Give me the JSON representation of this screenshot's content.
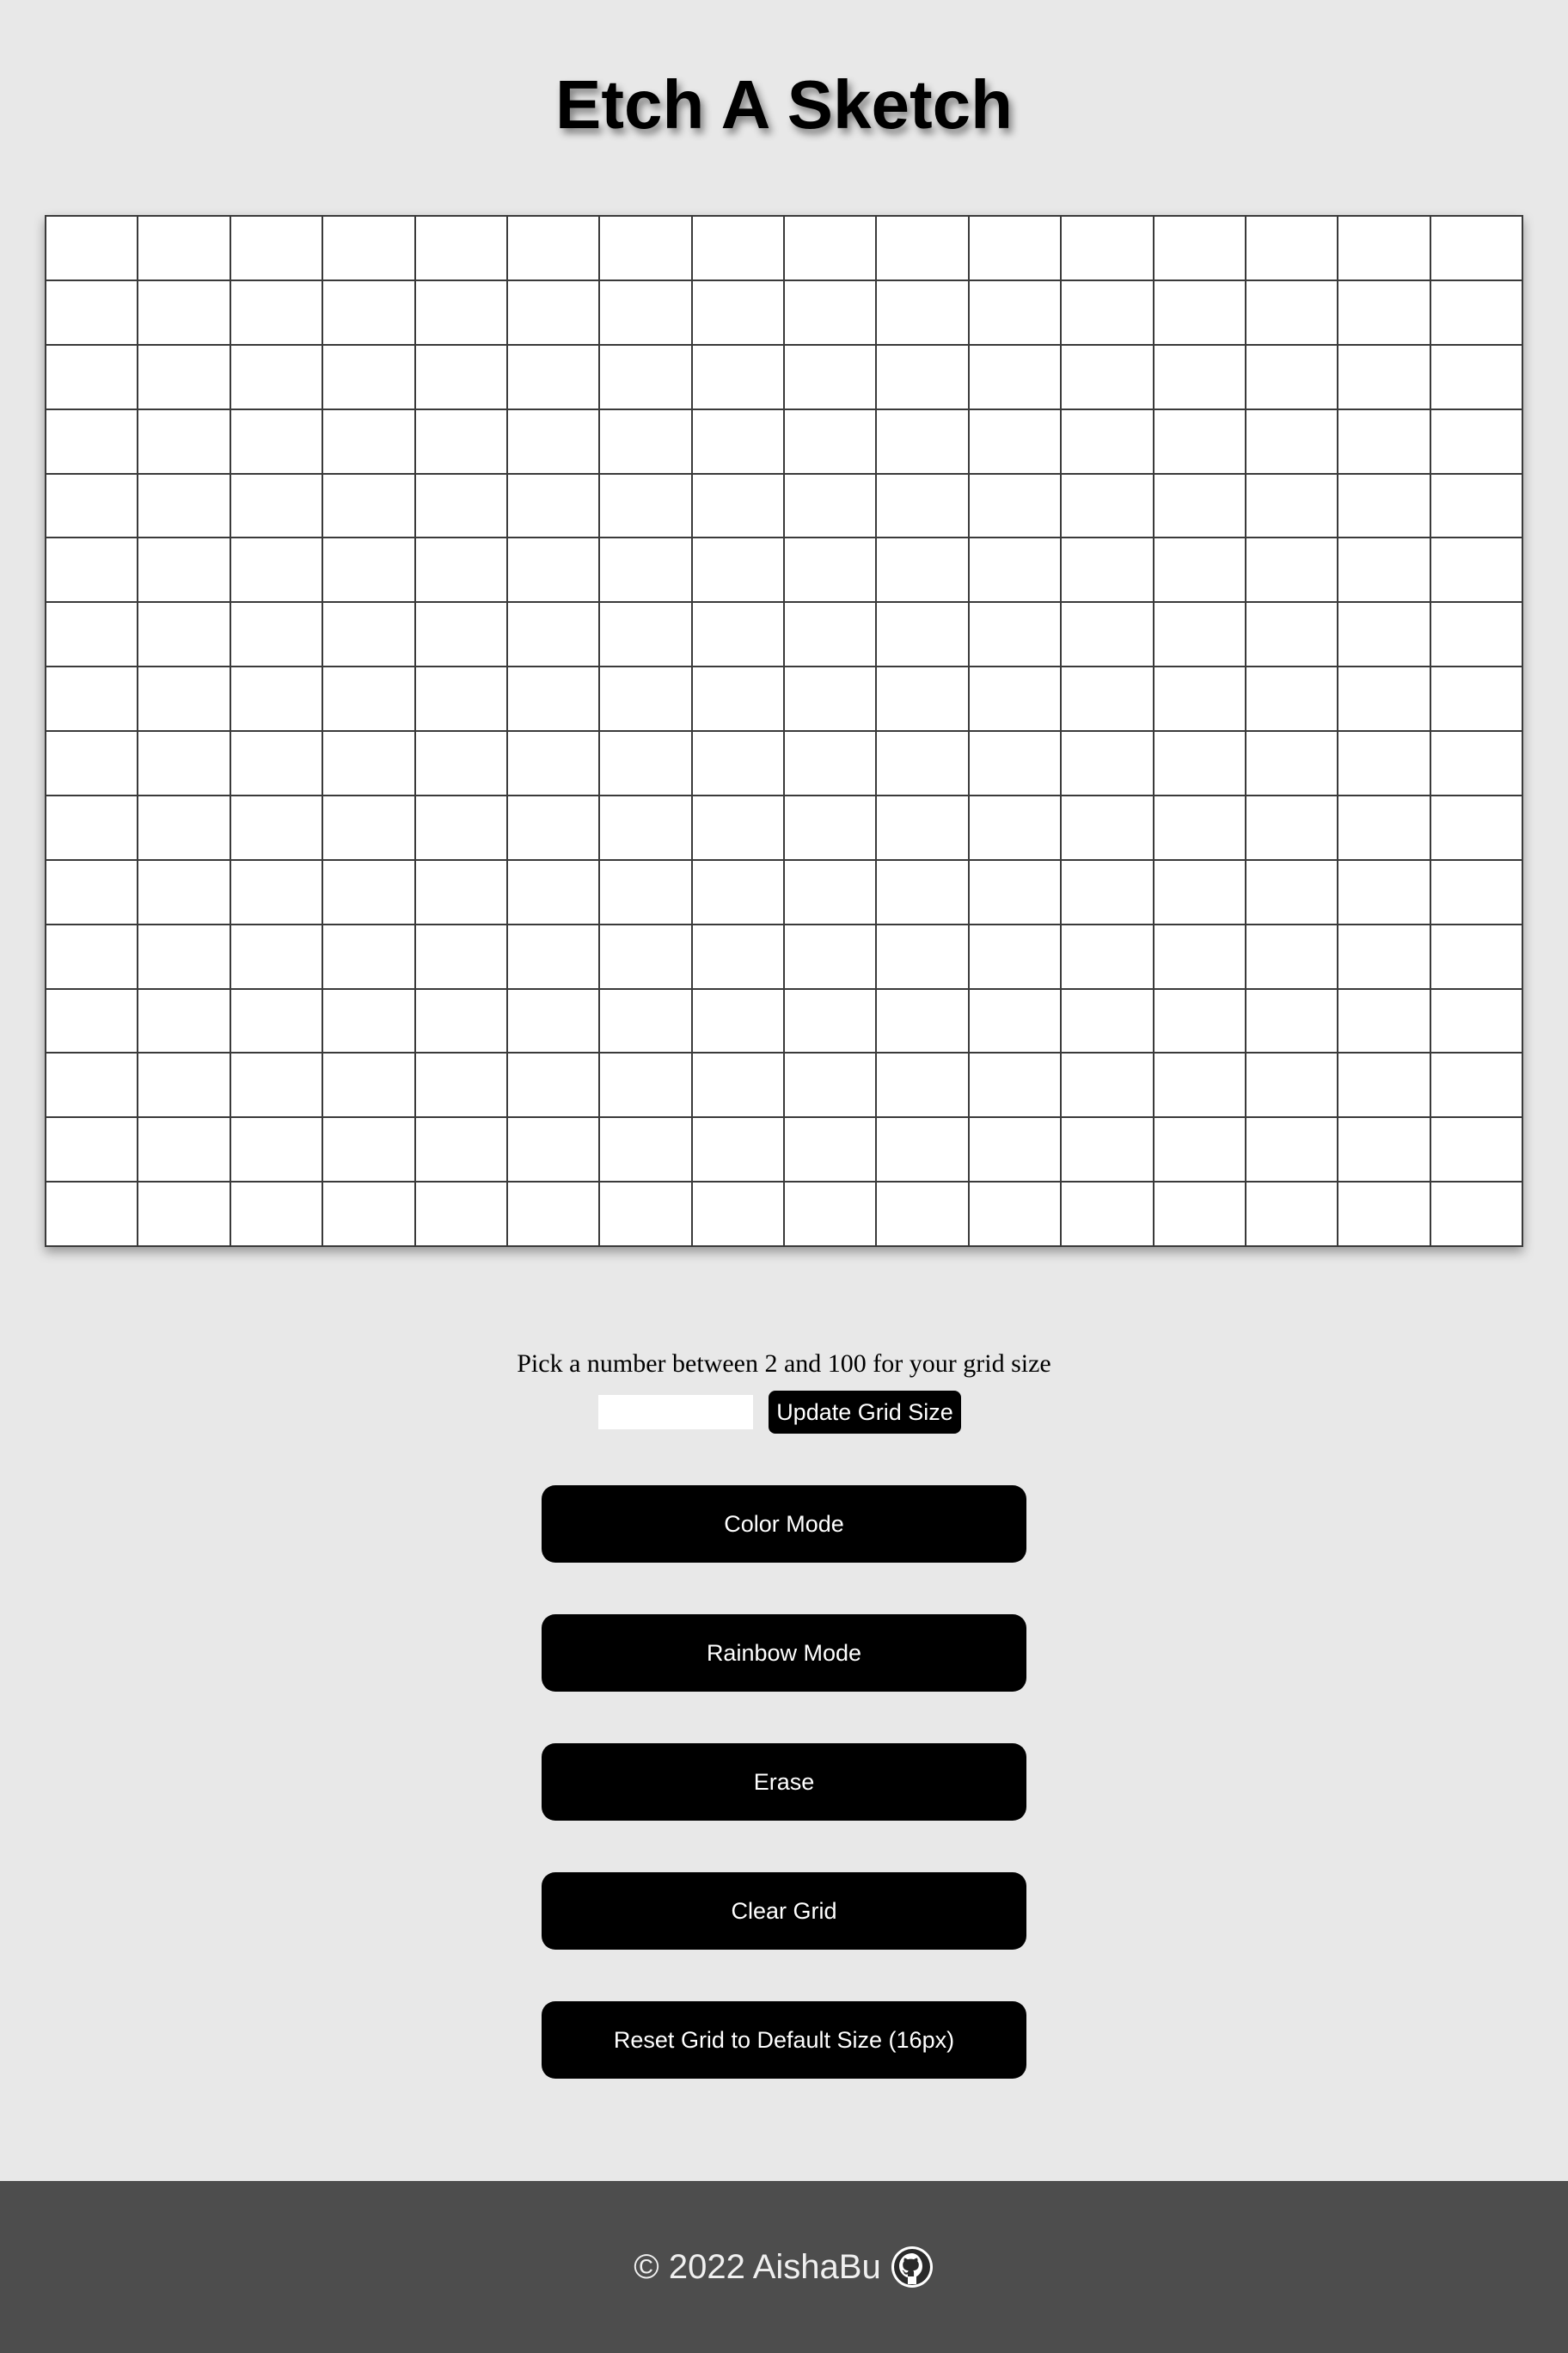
{
  "header": {
    "title": "Etch A Sketch"
  },
  "grid": {
    "rows": 16,
    "cols": 16,
    "cell_color": "#ffffff",
    "line_color": "#3a3a3a"
  },
  "controls": {
    "prompt": "Pick a number between 2 and 100 for your grid size",
    "size_input_value": "",
    "update_label": "Update Grid Size",
    "buttons": [
      {
        "label": "Color Mode"
      },
      {
        "label": "Rainbow Mode"
      },
      {
        "label": "Erase"
      },
      {
        "label": "Clear Grid"
      },
      {
        "label": "Reset Grid to Default Size (16px)"
      }
    ]
  },
  "footer": {
    "copyright": "© 2022 AishaBu",
    "icon": "github-icon"
  },
  "colors": {
    "page_background": "#e8e8e8",
    "button_background": "#000000",
    "button_text": "#ffffff",
    "footer_background": "#4d4d4d",
    "footer_text": "#f0f0f0"
  }
}
